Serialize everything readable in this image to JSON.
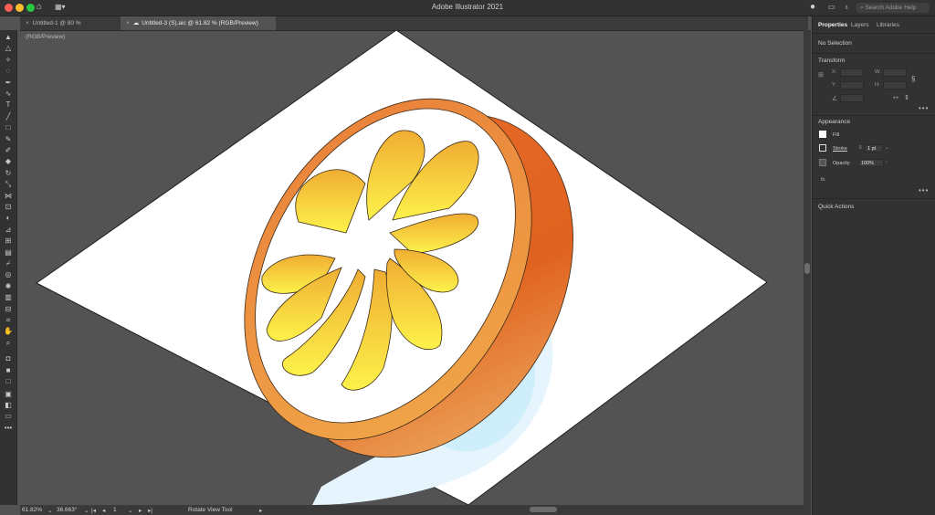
{
  "window": {
    "title": "Adobe Illustrator 2021",
    "search_placeholder": "Search Adobe Help"
  },
  "tabs": [
    {
      "label": "Untitled-1 @ 80 % (RGB/Preview)",
      "active": false
    },
    {
      "label": "Untitled-3 (S).aic @ 61.82 % (RGB/Preview)",
      "active": true
    }
  ],
  "panel": {
    "tabs": [
      "Properties",
      "Layers",
      "Libraries"
    ],
    "selection": "No Selection",
    "transform": {
      "title": "Transform",
      "x": "X:",
      "y": "Y:",
      "w": "W:",
      "h": "H:"
    },
    "appearance": {
      "title": "Appearance",
      "fill_label": "Fill",
      "stroke_label": "Stroke",
      "stroke_value": "1 pt",
      "opacity_label": "Opacity",
      "opacity_value": "100%",
      "fx": "fx."
    },
    "quick_actions": "Quick Actions"
  },
  "status": {
    "zoom": "61.82%",
    "rotation": "36.663°",
    "artboard": "1",
    "tool": "Rotate View Tool"
  },
  "colors": {
    "canvas": "#535353",
    "artboard": "#ffffff",
    "peel": "#ed8a3a",
    "peel_dark": "#e0621f",
    "segment_top": "#f0ad33",
    "segment_bottom": "#fdf24a",
    "shadow": "#cdeefa"
  },
  "tools": [
    "selection-icon",
    "direct-selection-icon",
    "magic-wand-icon",
    "lasso-icon",
    "pen-icon",
    "curvature-icon",
    "type-icon",
    "line-icon",
    "rectangle-icon",
    "paintbrush-icon",
    "shaper-icon",
    "eraser-icon",
    "rotate-icon",
    "scale-icon",
    "width-icon",
    "free-transform-icon",
    "shape-builder-icon",
    "perspective-icon",
    "mesh-icon",
    "gradient-icon",
    "eyedropper-icon",
    "blend-icon",
    "symbol-sprayer-icon",
    "column-graph-icon",
    "artboard-icon",
    "slice-icon",
    "hand-icon",
    "zoom-icon"
  ]
}
